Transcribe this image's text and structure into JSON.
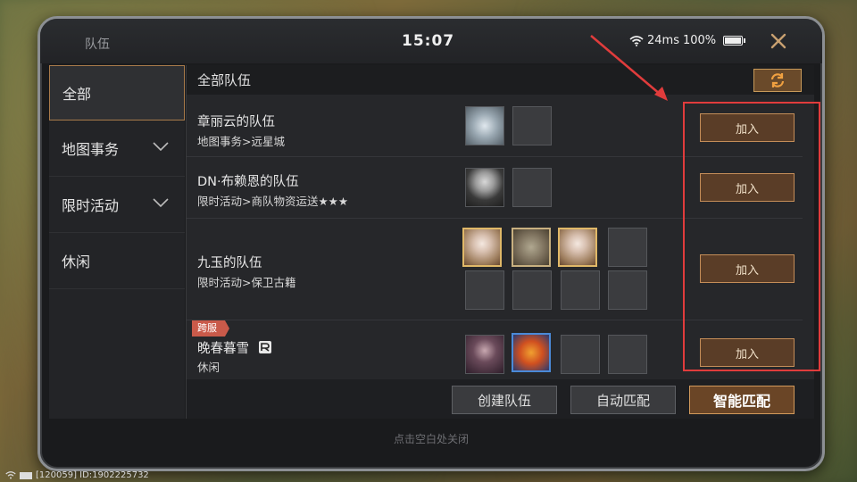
{
  "window": {
    "title": "队伍",
    "clock": "15:07",
    "latency": "24ms",
    "battery": "100%",
    "close_icon": "close-icon"
  },
  "sidebar": {
    "items": [
      {
        "label": "全部",
        "active": true,
        "expandable": false
      },
      {
        "label": "地图事务",
        "active": false,
        "expandable": true
      },
      {
        "label": "限时活动",
        "active": false,
        "expandable": true
      },
      {
        "label": "休闲",
        "active": false,
        "expandable": false
      }
    ]
  },
  "main": {
    "header": "全部队伍",
    "refresh_icon": "refresh-icon",
    "teams": [
      {
        "name": "章丽云的队伍",
        "activity": "地图事务>远星城",
        "join": "加入"
      },
      {
        "name": "DN·布赖恩的队伍",
        "activity": "限时活动>商队物资运送★★★",
        "join": "加入"
      },
      {
        "name": "九玉的队伍",
        "activity": "限时活动>保卫古籍",
        "join": "加入"
      },
      {
        "name": "晚春暮雪",
        "activity": "休闲",
        "tag": "跨服",
        "join": "加入"
      }
    ]
  },
  "footer": {
    "create": "创建队伍",
    "auto_match": "自动匹配",
    "smart_match": "智能匹配"
  },
  "hint": "点击空白处关闭",
  "bottom_status": "[120059] ID:1902225732",
  "colors": {
    "accent_gold": "#c48d58",
    "highlight_red": "#e03c3c"
  }
}
